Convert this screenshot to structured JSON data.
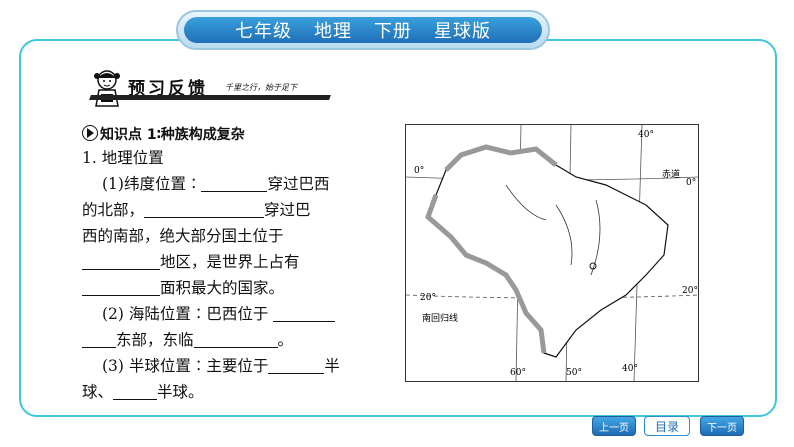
{
  "header": {
    "items": [
      "七年级",
      "地理",
      "下册",
      "星球版"
    ]
  },
  "banner": {
    "title": "预习反馈",
    "subtitle": "千里之行，始于足下"
  },
  "knowledge_point": {
    "label": "知识点 1∶种族构成复杂"
  },
  "content": {
    "section": "1. 地理位置",
    "lines": [
      {
        "parts": [
          "(1)纬度位置∶",
          "",
          "穿过巴西"
        ]
      },
      {
        "parts": [
          "的北部，",
          "",
          "穿过巴"
        ]
      },
      {
        "parts": [
          "西的南部，绝大部分国土位于"
        ]
      },
      {
        "parts": [
          "",
          "地区，是世界上占有"
        ]
      },
      {
        "parts": [
          "",
          "面积最大的国家。"
        ]
      },
      {
        "parts": [
          "(2) 海陆位置∶巴西位于 ",
          ""
        ]
      },
      {
        "parts": [
          "",
          "东部，东临",
          "。"
        ]
      },
      {
        "parts": [
          "(3) 半球位置∶主要位于",
          "半"
        ]
      },
      {
        "parts": [
          "球、",
          "半球。"
        ]
      }
    ]
  },
  "map": {
    "labels": {
      "lon40": "40°",
      "lat0w": "0°",
      "equator": "赤道",
      "lat0e": "0°",
      "lat20w": "20°",
      "lat20e": "20°",
      "tropic": "南回归线",
      "lon60": "60°",
      "lon50": "50°",
      "lon40b": "40°"
    }
  },
  "nav": {
    "prev": "上一页",
    "toc": "目录",
    "next": "下一页"
  },
  "colors": {
    "frame": "#3ec6e0",
    "header": "#1f6fb8",
    "border_gray": "#8a8a8a"
  }
}
